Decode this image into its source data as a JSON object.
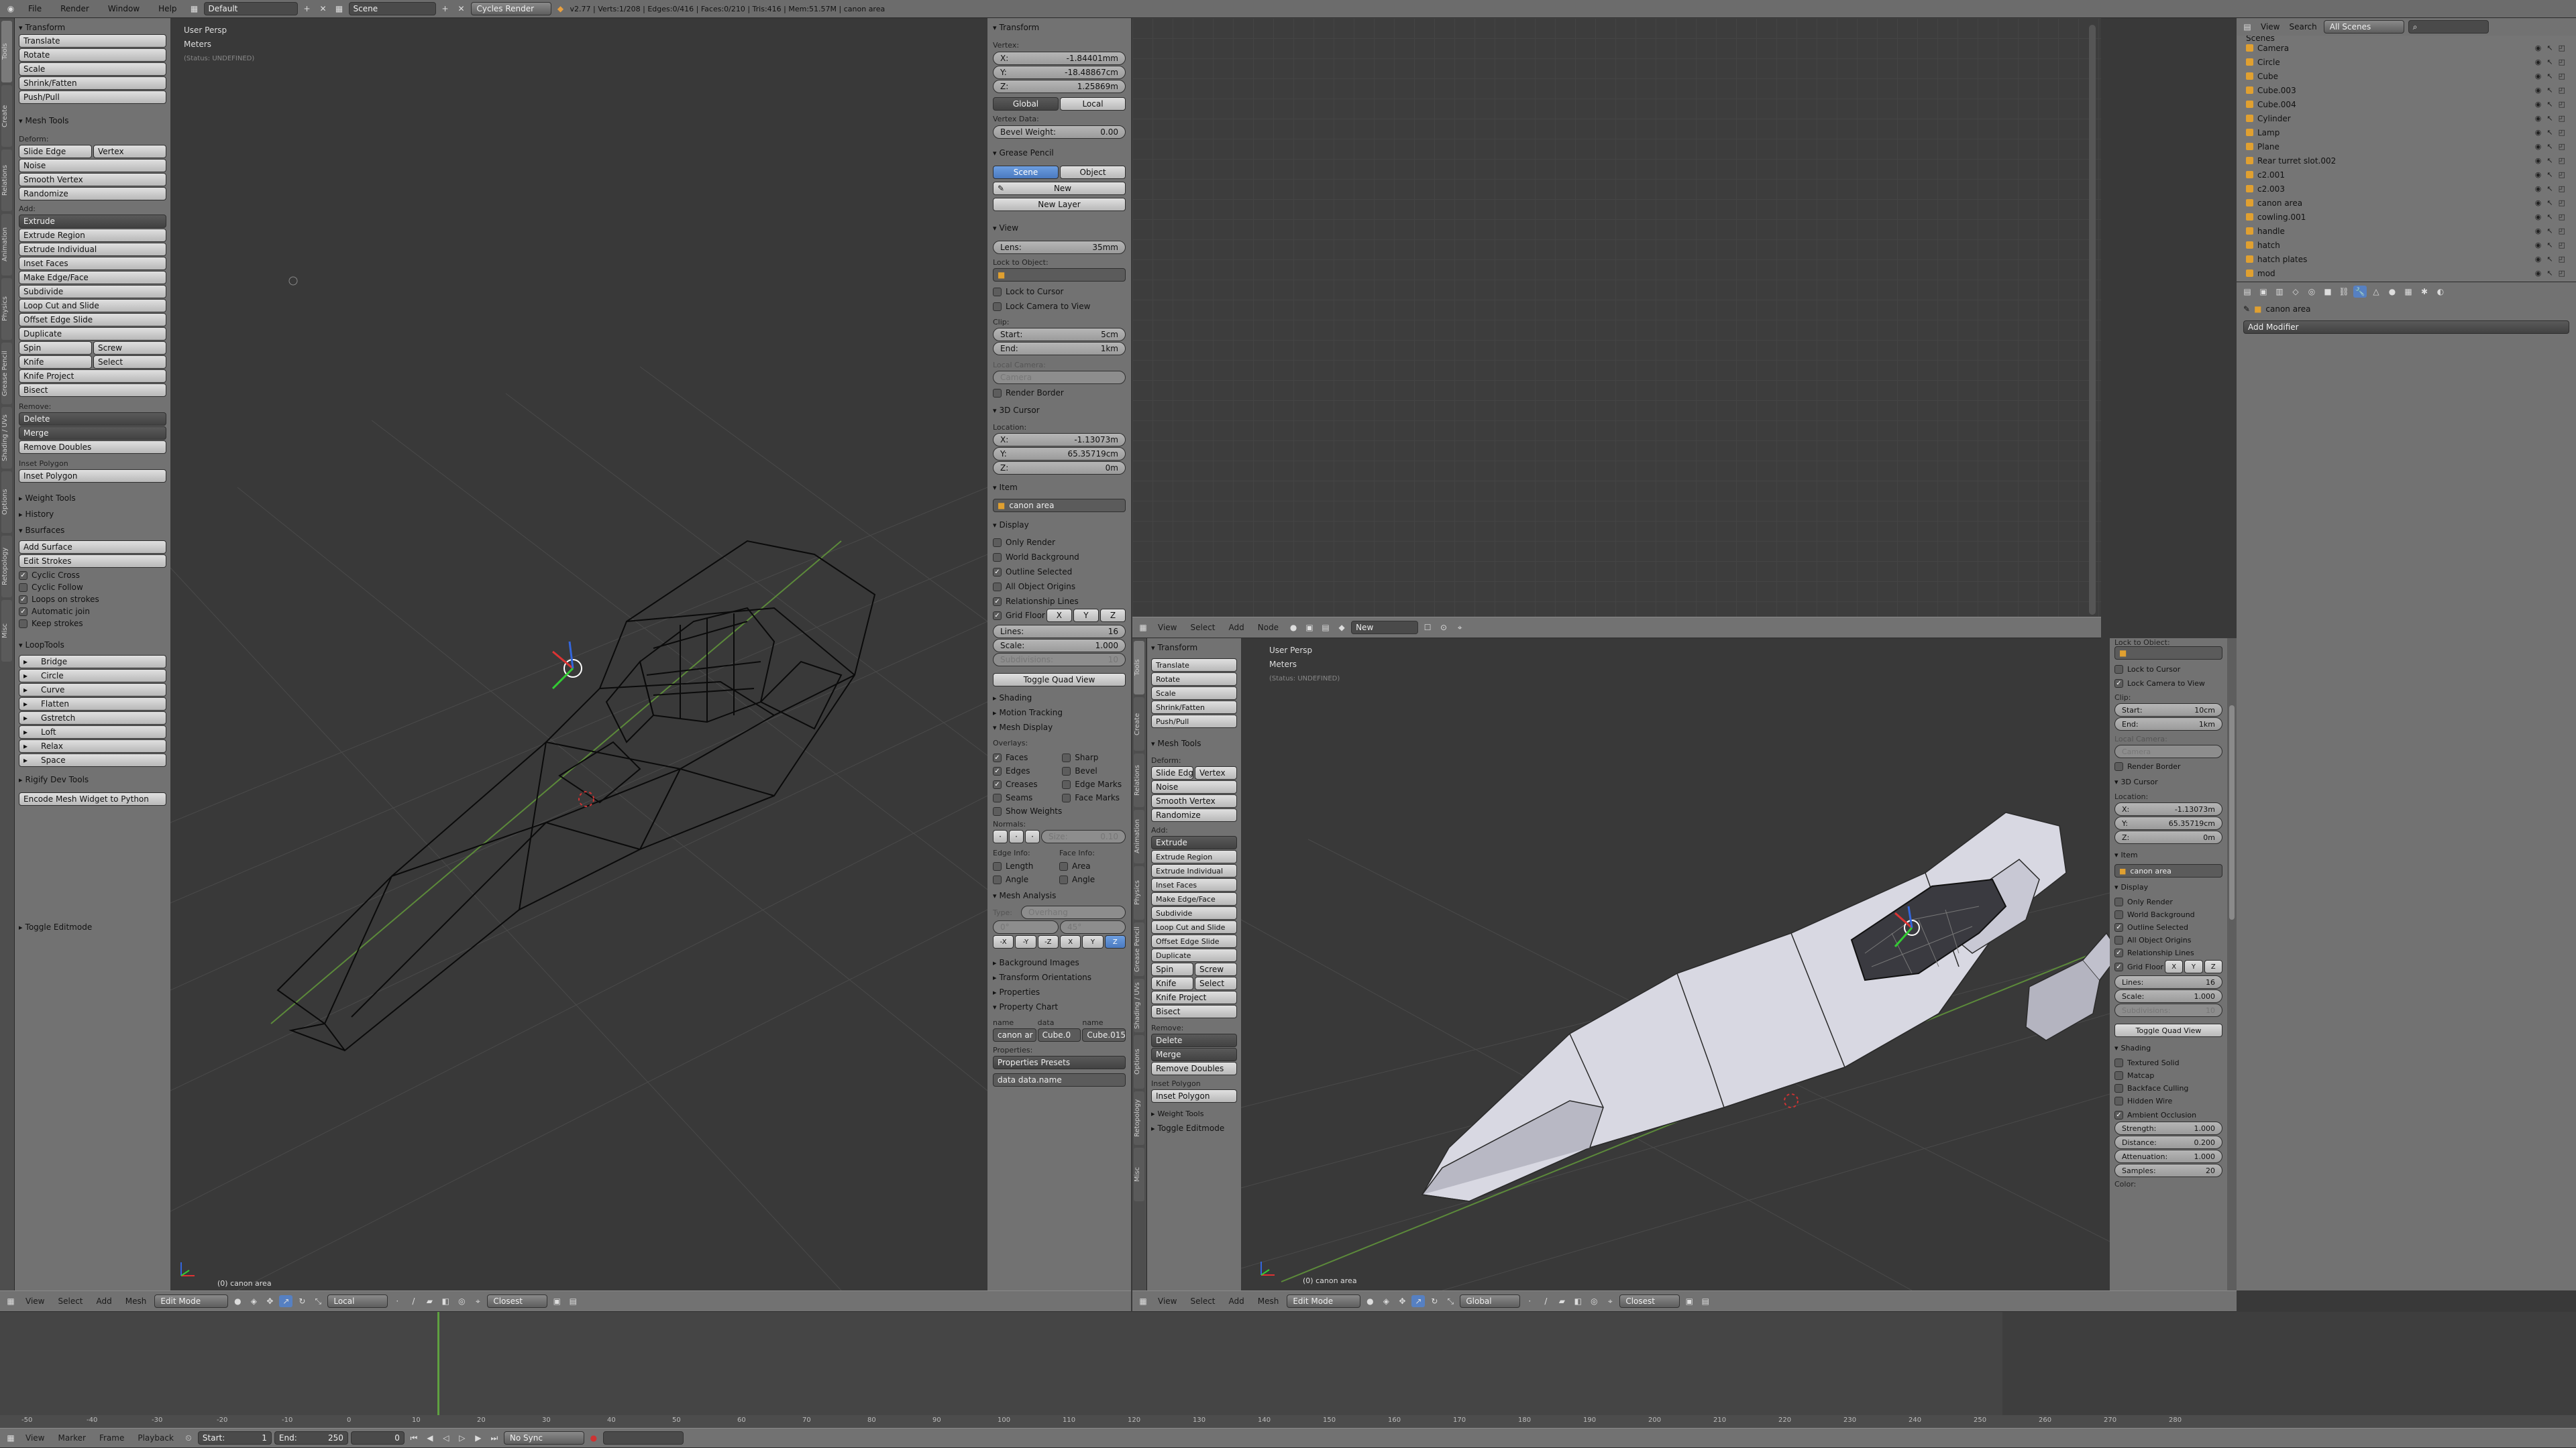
{
  "topbar": {
    "menus": [
      "File",
      "Render",
      "Window",
      "Help"
    ],
    "layout": "Default",
    "scene": "Scene",
    "engine": "Cycles Render",
    "stats": "v2.77 | Verts:1/208 | Edges:0/416 | Faces:0/210 | Tris:416 | Mem:51.57M | canon area"
  },
  "left_vp": {
    "persp": "User Persp",
    "units": "Meters",
    "status": "(Status: UNDEFINED)",
    "object": "(0) canon area",
    "header_menus": [
      "View",
      "Select",
      "Add",
      "Mesh"
    ],
    "mode": "Edit Mode",
    "orientation": "Local",
    "snap": "Closest"
  },
  "right_vp": {
    "persp": "User Persp",
    "units": "Meters",
    "status": "(Status: UNDEFINED)",
    "object": "(0) canon area",
    "header_menus": [
      "View",
      "Select",
      "Add",
      "Mesh"
    ],
    "mode": "Edit Mode",
    "orientation": "Global",
    "snap": "Closest"
  },
  "node_editor": {
    "header_menus": [
      "View",
      "Select",
      "Add",
      "Node"
    ],
    "new_label": "New"
  },
  "toolshelf_left": {
    "transform_title": "Transform",
    "transform_items": [
      "Translate",
      "Rotate",
      "Scale",
      "Shrink/Fatten",
      "Push/Pull"
    ],
    "mesh_tools_title": "Mesh Tools",
    "deform_label": "Deform:",
    "slide_edge": "Slide Edge",
    "vertex": "Vertex",
    "deform_items": [
      "Noise",
      "Smooth Vertex",
      "Randomize"
    ],
    "add_label": "Add:",
    "extrude": "Extrude",
    "add_items": [
      "Extrude Region",
      "Extrude Individual",
      "Inset Faces",
      "Make Edge/Face",
      "Subdivide",
      "Loop Cut and Slide",
      "Offset Edge Slide",
      "Duplicate"
    ],
    "spin": "Spin",
    "screw": "Screw",
    "knife": "Knife",
    "select": "Select",
    "knife_project": "Knife Project",
    "bisect": "Bisect",
    "remove_label": "Remove:",
    "delete": "Delete",
    "merge": "Merge",
    "remove_doubles": "Remove Doubles",
    "inset_polygon_label": "Inset Polygon",
    "inset_polygon_btn": "Inset Polygon",
    "weight_tools": "Weight Tools",
    "history": "History",
    "bsurfaces": "Bsurfaces",
    "add_surface": "Add Surface",
    "edit_strokes": "Edit Strokes",
    "bs_checks": [
      {
        "label": "Cyclic Cross",
        "on": true
      },
      {
        "label": "Cyclic Follow",
        "on": false
      },
      {
        "label": "Loops on strokes",
        "on": true
      },
      {
        "label": "Automatic join",
        "on": true
      },
      {
        "label": "Keep strokes",
        "on": false
      }
    ],
    "looptools": "LoopTools",
    "loop_items": [
      "Bridge",
      "Circle",
      "Curve",
      "Flatten",
      "Gstretch",
      "Loft",
      "Relax",
      "Space"
    ],
    "rigify": "Rigify Dev Tools",
    "encode": "Encode Mesh Widget to Python",
    "toggle_editmode": "Toggle Editmode",
    "tabs": [
      "Tools",
      "Create",
      "Relations",
      "Animation",
      "Physics",
      "Grease Pencil",
      "Shading / UVs",
      "Options",
      "Retopology",
      "Misc"
    ]
  },
  "props_left": {
    "transform": "Transform",
    "vertex_label": "Vertex:",
    "x": "-1.84401mm",
    "y": "-18.48867cm",
    "z": "1.25869m",
    "global": "Global",
    "local": "Local",
    "vertex_data": "Vertex Data:",
    "bevel_weight": "Bevel Weight:",
    "bevel_value": "0.00",
    "grease_pencil": "Grease Pencil",
    "scene": "Scene",
    "object": "Object",
    "new": "New",
    "new_layer": "New Layer",
    "view": "View",
    "lens": "Lens:",
    "lens_value": "35mm",
    "lock_to_object": "Lock to Object:",
    "lock_to_cursor": "Lock to Cursor",
    "lock_camera": "Lock Camera to View",
    "clip": "Clip:",
    "start": "Start:",
    "start_value": "5cm",
    "end": "End:",
    "end_value": "1km",
    "local_camera": "Local Camera:",
    "camera": "Camera",
    "render_border": "Render Border",
    "cursor_3d": "3D Cursor",
    "location": "Location:",
    "cx": "-1.13073m",
    "cy": "65.35719cm",
    "cz": "0m",
    "item": "Item",
    "item_name": "canon area",
    "display": "Display",
    "display_checks": [
      {
        "label": "Only Render",
        "on": false
      },
      {
        "label": "World Background",
        "on": false
      },
      {
        "label": "Outline Selected",
        "on": true
      },
      {
        "label": "All Object Origins",
        "on": false
      },
      {
        "label": "Relationship Lines",
        "on": true
      }
    ],
    "grid_floor": "Grid Floor",
    "xyz": [
      "X",
      "Y",
      "Z"
    ],
    "lines": "Lines:",
    "lines_value": "16",
    "scale": "Scale:",
    "scale_value": "1.000",
    "subdivisions": "Subdivisions:",
    "subdivisions_value": "10",
    "toggle_quad": "Toggle Quad View",
    "shading": "Shading",
    "motion_tracking": "Motion Tracking",
    "mesh_display": "Mesh Display",
    "overlays": "Overlays:",
    "overlay_left": [
      {
        "label": "Faces",
        "on": true
      },
      {
        "label": "Edges",
        "on": true
      },
      {
        "label": "Creases",
        "on": true
      },
      {
        "label": "Seams",
        "on": false
      },
      {
        "label": "Show Weights",
        "on": false
      }
    ],
    "overlay_right": [
      {
        "label": "Sharp",
        "on": false
      },
      {
        "label": "Bevel",
        "on": false
      },
      {
        "label": "Edge Marks",
        "on": false
      },
      {
        "label": "Face Marks",
        "on": false
      }
    ],
    "normals": "Normals:",
    "size": "Size:",
    "size_value": "0.10",
    "edge_info": "Edge Info:",
    "face_info": "Face Info:",
    "length": "Length",
    "angle": "Angle",
    "area": "Area",
    "angle2": "Angle",
    "mesh_analysis": "Mesh Analysis",
    "type": "Type:",
    "overhang": "Overhang",
    "ma_min": "0°",
    "ma_max": "45°",
    "ma_axis": [
      "-X",
      "-Y",
      "-Z",
      "X",
      "Y",
      "Z"
    ],
    "background_images": "Background Images",
    "transform_orientations": "Transform Orientations",
    "properties": "Properties",
    "property_chart": "Property Chart",
    "pc_name": "name",
    "pc_data": "data",
    "pc_name2": "name",
    "pc_values": [
      "canon ar",
      "Cube.0",
      "Cube.015"
    ],
    "properties_label": "Properties:",
    "properties_presets": "Properties Presets",
    "data_name": "data data.name"
  },
  "toolshelf_right": {
    "transform": "Transform",
    "items": [
      "Translate",
      "Rotate",
      "Scale",
      "Shrink/Fatten",
      "Push/Pull"
    ],
    "mesh_tools": "Mesh Tools",
    "deform": "Deform:",
    "slide_edge": "Slide Edg",
    "vertex": "Vertex",
    "noise": "Noise",
    "smooth": "Smooth Vertex",
    "randomize": "Randomize",
    "add": "Add:",
    "extrude": "Extrude",
    "add_items": [
      "Extrude Region",
      "Extrude Individual",
      "Inset Faces",
      "Make Edge/Face",
      "Subdivide",
      "Loop Cut and Slide",
      "Offset Edge Slide",
      "Duplicate"
    ],
    "spin": "Spin",
    "screw": "Screw",
    "knife": "Knife",
    "select": "Select",
    "knife_project": "Knife Project",
    "bisect": "Bisect",
    "remove": "Remove:",
    "delete": "Delete",
    "merge": "Merge",
    "remove_doubles": "Remove Doubles",
    "inset_polygon": "Inset Polygon",
    "inset_polygon_btn": "Inset Polygon",
    "weight_tools": "Weight Tools",
    "toggle_editmode": "Toggle Editmode"
  },
  "props_right": {
    "lock_to_object": "Lock to Object:",
    "lock_to_cursor": "Lock to Cursor",
    "lock_camera": "Lock Camera to View",
    "clip": "Clip:",
    "start": "Start:",
    "start_value": "10cm",
    "end": "End:",
    "end_value": "1km",
    "local_camera": "Local Camera:",
    "camera": "Camera",
    "render_border": "Render Border",
    "cursor_3d": "3D Cursor",
    "location": "Location:",
    "cx": "-1.13073m",
    "cy": "65.35719cm",
    "cz": "0m",
    "item": "Item",
    "item_name": "canon area",
    "display": "Display",
    "checks": [
      {
        "label": "Only Render",
        "on": false
      },
      {
        "label": "World Background",
        "on": false
      },
      {
        "label": "Outline Selected",
        "on": true
      },
      {
        "label": "All Object Origins",
        "on": false
      },
      {
        "label": "Relationship Lines",
        "on": true
      }
    ],
    "grid_floor": "Grid Floor",
    "lines": "Lines:",
    "lines_value": "16",
    "scale": "Scale:",
    "scale_value": "1.000",
    "subdivisions": "Subdivisions:",
    "subdivisions_value": "10",
    "toggle_quad": "Toggle Quad View",
    "shading": "Shading",
    "shading_checks": [
      {
        "label": "Textured Solid",
        "on": false
      },
      {
        "label": "Matcap",
        "on": false
      },
      {
        "label": "Backface Culling",
        "on": false
      },
      {
        "label": "Hidden Wire",
        "on": false
      }
    ],
    "ambient": "Ambient Occlusion",
    "strength": "Strength:",
    "strength_value": "1.000",
    "distance": "Distance:",
    "distance_value": "0.200",
    "attenuation": "Attenuation:",
    "attenuation_value": "1.000",
    "samples": "Samples:",
    "samples_value": "20",
    "color": "Color:"
  },
  "outliner": {
    "view": "View",
    "search": "Search",
    "filter": "All Scenes",
    "scenes_row": "Scenes",
    "items": [
      "Camera",
      "Circle",
      "Cube",
      "Cube.003",
      "Cube.004",
      "Cylinder",
      "Lamp",
      "Plane",
      "Rear turret slot.002",
      "c2.001",
      "c2.003",
      "canon area",
      "cowling.001",
      "handle",
      "hatch",
      "hatch plates",
      "mod"
    ]
  },
  "properties_editor": {
    "object": "canon area",
    "add_modifier": "Add Modifier"
  },
  "timeline": {
    "menus": [
      "View",
      "Marker",
      "Frame",
      "Playback"
    ],
    "start_label": "Start:",
    "start": "1",
    "end_label": "End:",
    "end": "250",
    "current": "0",
    "sync": "No Sync",
    "ruler": [
      "-50",
      "-40",
      "-30",
      "-20",
      "-10",
      "0",
      "10",
      "20",
      "30",
      "40",
      "50",
      "60",
      "70",
      "80",
      "90",
      "100",
      "110",
      "120",
      "130",
      "140",
      "150",
      "160",
      "170",
      "180",
      "190",
      "200",
      "210",
      "220",
      "230",
      "240",
      "250",
      "260",
      "270",
      "280"
    ]
  }
}
